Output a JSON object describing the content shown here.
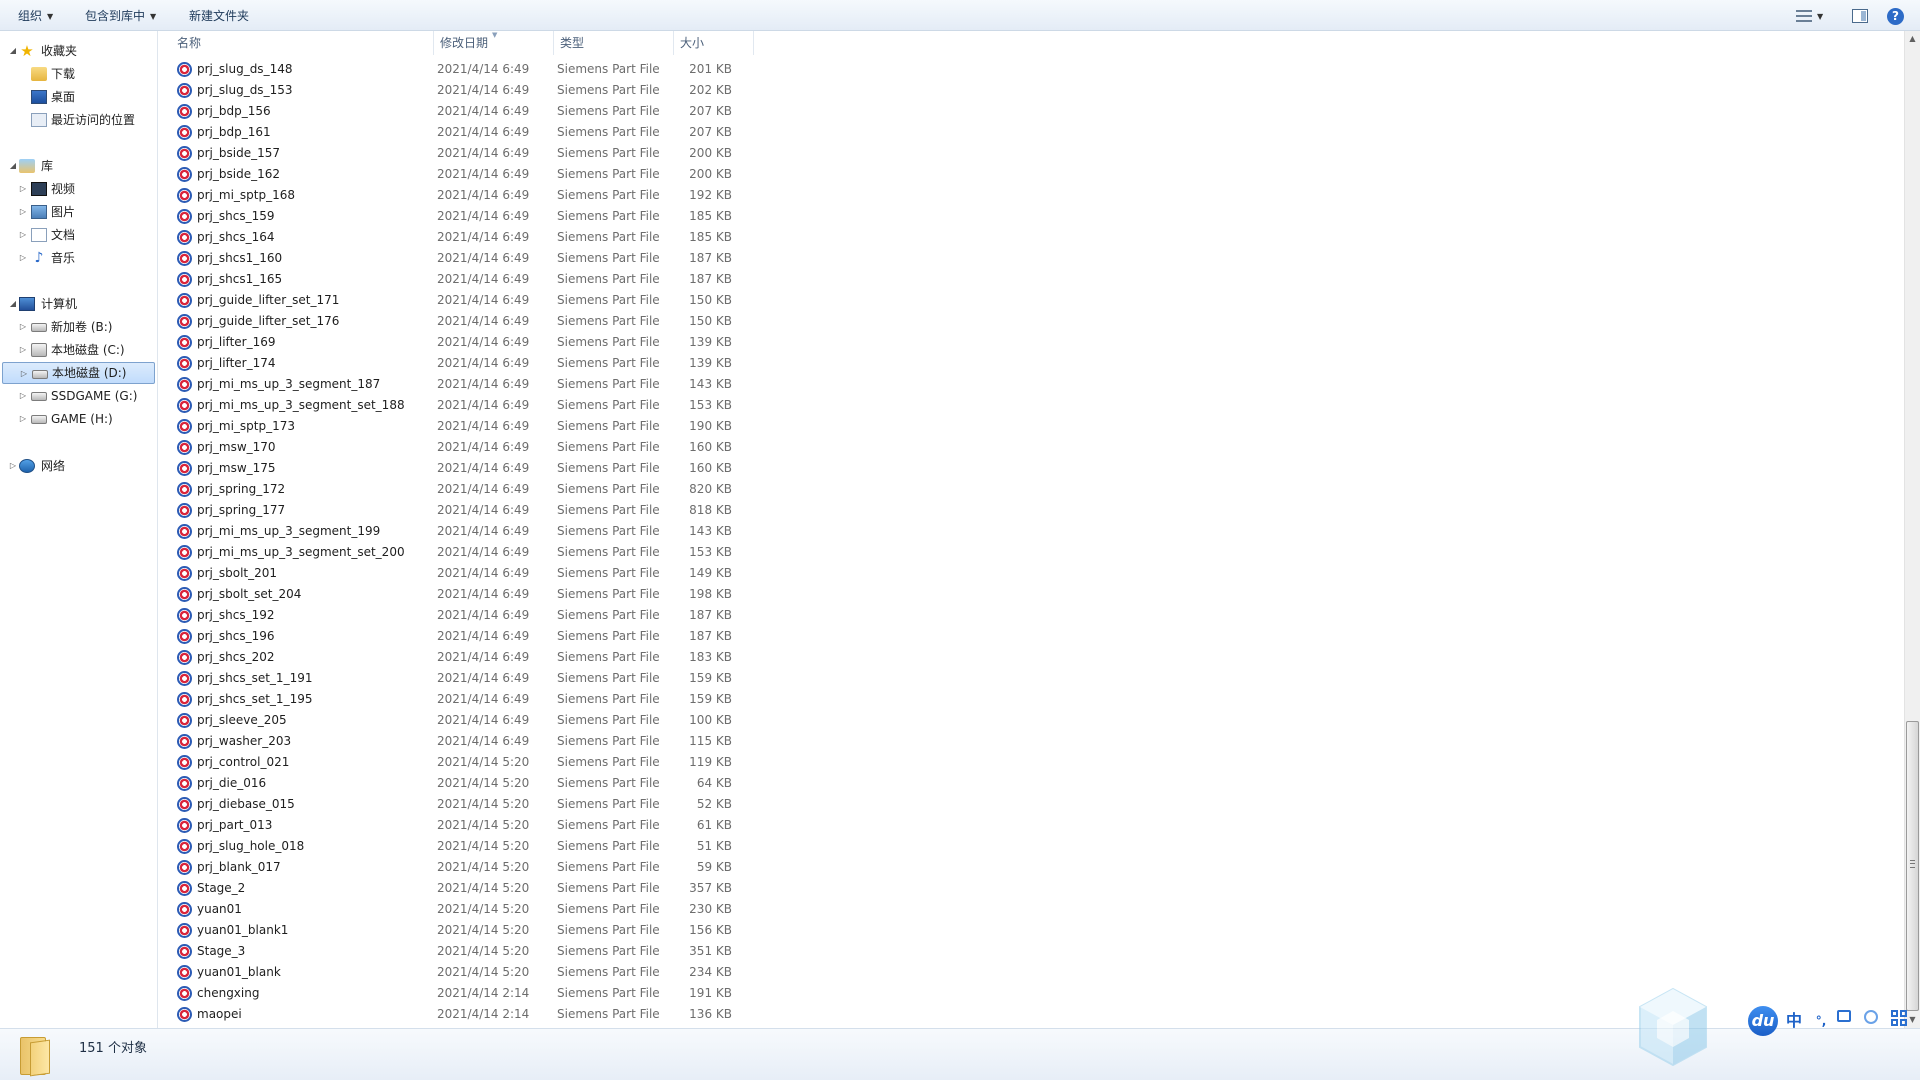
{
  "toolbar": {
    "organize": "组织",
    "include_in_library": "包含到库中",
    "new_folder": "新建文件夹",
    "help": "?"
  },
  "nav": {
    "favorites": {
      "label": "收藏夹",
      "items": [
        {
          "label": "下载",
          "icon": "download-folder-icon"
        },
        {
          "label": "桌面",
          "icon": "desktop-icon"
        },
        {
          "label": "最近访问的位置",
          "icon": "recent-places-icon"
        }
      ]
    },
    "libraries": {
      "label": "库",
      "items": [
        {
          "label": "视频",
          "icon": "video-library-icon"
        },
        {
          "label": "图片",
          "icon": "picture-library-icon"
        },
        {
          "label": "文档",
          "icon": "document-library-icon"
        },
        {
          "label": "音乐",
          "icon": "music-library-icon"
        }
      ]
    },
    "computer": {
      "label": "计算机",
      "items": [
        {
          "label": "新加卷 (B:)",
          "icon": "drive-icon"
        },
        {
          "label": "本地磁盘 (C:)",
          "icon": "system-drive-icon"
        },
        {
          "label": "本地磁盘 (D:)",
          "icon": "drive-icon",
          "selected": true
        },
        {
          "label": "SSDGAME (G:)",
          "icon": "drive-icon"
        },
        {
          "label": "GAME (H:)",
          "icon": "drive-icon"
        }
      ]
    },
    "network": {
      "label": "网络"
    }
  },
  "columns": {
    "name": "名称",
    "date": "修改日期",
    "type": "类型",
    "size": "大小"
  },
  "files": [
    {
      "name": "prj_slug_ds_148",
      "date": "2021/4/14 6:49",
      "type": "Siemens Part File",
      "size": "201 KB"
    },
    {
      "name": "prj_slug_ds_153",
      "date": "2021/4/14 6:49",
      "type": "Siemens Part File",
      "size": "202 KB"
    },
    {
      "name": "prj_bdp_156",
      "date": "2021/4/14 6:49",
      "type": "Siemens Part File",
      "size": "207 KB"
    },
    {
      "name": "prj_bdp_161",
      "date": "2021/4/14 6:49",
      "type": "Siemens Part File",
      "size": "207 KB"
    },
    {
      "name": "prj_bside_157",
      "date": "2021/4/14 6:49",
      "type": "Siemens Part File",
      "size": "200 KB"
    },
    {
      "name": "prj_bside_162",
      "date": "2021/4/14 6:49",
      "type": "Siemens Part File",
      "size": "200 KB"
    },
    {
      "name": "prj_mi_sptp_168",
      "date": "2021/4/14 6:49",
      "type": "Siemens Part File",
      "size": "192 KB"
    },
    {
      "name": "prj_shcs_159",
      "date": "2021/4/14 6:49",
      "type": "Siemens Part File",
      "size": "185 KB"
    },
    {
      "name": "prj_shcs_164",
      "date": "2021/4/14 6:49",
      "type": "Siemens Part File",
      "size": "185 KB"
    },
    {
      "name": "prj_shcs1_160",
      "date": "2021/4/14 6:49",
      "type": "Siemens Part File",
      "size": "187 KB"
    },
    {
      "name": "prj_shcs1_165",
      "date": "2021/4/14 6:49",
      "type": "Siemens Part File",
      "size": "187 KB"
    },
    {
      "name": "prj_guide_lifter_set_171",
      "date": "2021/4/14 6:49",
      "type": "Siemens Part File",
      "size": "150 KB"
    },
    {
      "name": "prj_guide_lifter_set_176",
      "date": "2021/4/14 6:49",
      "type": "Siemens Part File",
      "size": "150 KB"
    },
    {
      "name": "prj_lifter_169",
      "date": "2021/4/14 6:49",
      "type": "Siemens Part File",
      "size": "139 KB"
    },
    {
      "name": "prj_lifter_174",
      "date": "2021/4/14 6:49",
      "type": "Siemens Part File",
      "size": "139 KB"
    },
    {
      "name": "prj_mi_ms_up_3_segment_187",
      "date": "2021/4/14 6:49",
      "type": "Siemens Part File",
      "size": "143 KB"
    },
    {
      "name": "prj_mi_ms_up_3_segment_set_188",
      "date": "2021/4/14 6:49",
      "type": "Siemens Part File",
      "size": "153 KB"
    },
    {
      "name": "prj_mi_sptp_173",
      "date": "2021/4/14 6:49",
      "type": "Siemens Part File",
      "size": "190 KB"
    },
    {
      "name": "prj_msw_170",
      "date": "2021/4/14 6:49",
      "type": "Siemens Part File",
      "size": "160 KB"
    },
    {
      "name": "prj_msw_175",
      "date": "2021/4/14 6:49",
      "type": "Siemens Part File",
      "size": "160 KB"
    },
    {
      "name": "prj_spring_172",
      "date": "2021/4/14 6:49",
      "type": "Siemens Part File",
      "size": "820 KB"
    },
    {
      "name": "prj_spring_177",
      "date": "2021/4/14 6:49",
      "type": "Siemens Part File",
      "size": "818 KB"
    },
    {
      "name": "prj_mi_ms_up_3_segment_199",
      "date": "2021/4/14 6:49",
      "type": "Siemens Part File",
      "size": "143 KB"
    },
    {
      "name": "prj_mi_ms_up_3_segment_set_200",
      "date": "2021/4/14 6:49",
      "type": "Siemens Part File",
      "size": "153 KB"
    },
    {
      "name": "prj_sbolt_201",
      "date": "2021/4/14 6:49",
      "type": "Siemens Part File",
      "size": "149 KB"
    },
    {
      "name": "prj_sbolt_set_204",
      "date": "2021/4/14 6:49",
      "type": "Siemens Part File",
      "size": "198 KB"
    },
    {
      "name": "prj_shcs_192",
      "date": "2021/4/14 6:49",
      "type": "Siemens Part File",
      "size": "187 KB"
    },
    {
      "name": "prj_shcs_196",
      "date": "2021/4/14 6:49",
      "type": "Siemens Part File",
      "size": "187 KB"
    },
    {
      "name": "prj_shcs_202",
      "date": "2021/4/14 6:49",
      "type": "Siemens Part File",
      "size": "183 KB"
    },
    {
      "name": "prj_shcs_set_1_191",
      "date": "2021/4/14 6:49",
      "type": "Siemens Part File",
      "size": "159 KB"
    },
    {
      "name": "prj_shcs_set_1_195",
      "date": "2021/4/14 6:49",
      "type": "Siemens Part File",
      "size": "159 KB"
    },
    {
      "name": "prj_sleeve_205",
      "date": "2021/4/14 6:49",
      "type": "Siemens Part File",
      "size": "100 KB"
    },
    {
      "name": "prj_washer_203",
      "date": "2021/4/14 6:49",
      "type": "Siemens Part File",
      "size": "115 KB"
    },
    {
      "name": "prj_control_021",
      "date": "2021/4/14 5:20",
      "type": "Siemens Part File",
      "size": "119 KB"
    },
    {
      "name": "prj_die_016",
      "date": "2021/4/14 5:20",
      "type": "Siemens Part File",
      "size": "64 KB"
    },
    {
      "name": "prj_diebase_015",
      "date": "2021/4/14 5:20",
      "type": "Siemens Part File",
      "size": "52 KB"
    },
    {
      "name": "prj_part_013",
      "date": "2021/4/14 5:20",
      "type": "Siemens Part File",
      "size": "61 KB"
    },
    {
      "name": "prj_slug_hole_018",
      "date": "2021/4/14 5:20",
      "type": "Siemens Part File",
      "size": "51 KB"
    },
    {
      "name": "prj_blank_017",
      "date": "2021/4/14 5:20",
      "type": "Siemens Part File",
      "size": "59 KB"
    },
    {
      "name": "Stage_2",
      "date": "2021/4/14 5:20",
      "type": "Siemens Part File",
      "size": "357 KB"
    },
    {
      "name": "yuan01",
      "date": "2021/4/14 5:20",
      "type": "Siemens Part File",
      "size": "230 KB"
    },
    {
      "name": "yuan01_blank1",
      "date": "2021/4/14 5:20",
      "type": "Siemens Part File",
      "size": "156 KB"
    },
    {
      "name": "Stage_3",
      "date": "2021/4/14 5:20",
      "type": "Siemens Part File",
      "size": "351 KB"
    },
    {
      "name": "yuan01_blank",
      "date": "2021/4/14 5:20",
      "type": "Siemens Part File",
      "size": "234 KB"
    },
    {
      "name": "chengxing",
      "date": "2021/4/14 2:14",
      "type": "Siemens Part File",
      "size": "191 KB"
    },
    {
      "name": "maopei",
      "date": "2021/4/14 2:14",
      "type": "Siemens Part File",
      "size": "136 KB"
    }
  ],
  "status": {
    "count": "151 个对象"
  },
  "ime": {
    "logo": "du",
    "mode": "中",
    "punct": "°,"
  },
  "colors": {
    "accent": "#2b5bb5",
    "selection": "#c1dcfc",
    "part_icon_red": "#d9263c"
  }
}
